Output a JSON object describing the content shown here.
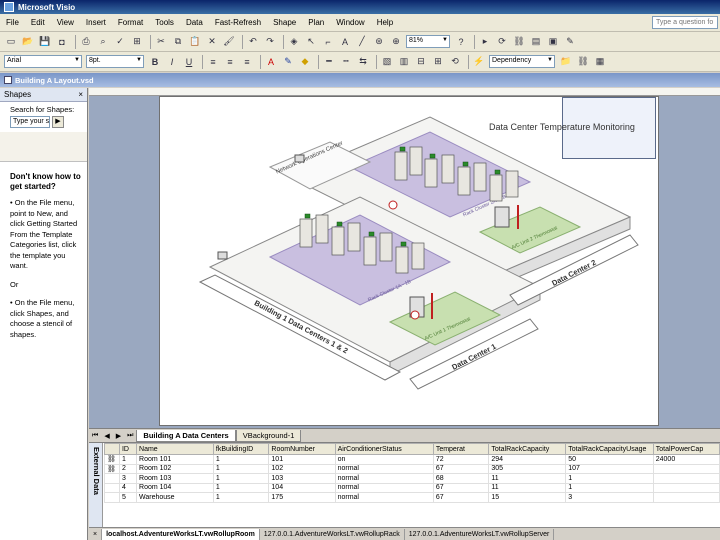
{
  "window": {
    "title": "Microsoft Visio"
  },
  "menu": {
    "items": [
      "File",
      "Edit",
      "View",
      "Insert",
      "Format",
      "Tools",
      "Data",
      "Fast-Refresh",
      "Shape",
      "Plan",
      "Window",
      "Help"
    ],
    "help_placeholder": "Type a question fo"
  },
  "toolbar1": {
    "zoom": "81%"
  },
  "toolbar2": {
    "font": "Arial",
    "size": "8pt.",
    "dependency": "Dependency"
  },
  "document": {
    "title": "Building A Layout.vsd"
  },
  "shapes_pane": {
    "title": "Shapes",
    "search_label": "Search for Shapes:",
    "search_placeholder": "Type your s",
    "help_heading": "Don't know how to get started?",
    "help_steps": [
      "On the File menu, point to New, and click Getting Started From the Template Categories list, click the template you want.",
      "On the File menu, click Shapes, and choose a stencil of shapes."
    ],
    "or_text": "Or",
    "bullet": "•"
  },
  "diagram": {
    "title": "Data Center Temperature Monitoring",
    "labels": {
      "building": "Building 1 Data Centers 1 & 2",
      "dc1": "Data Center 1",
      "dc2": "Data Center 2",
      "noc": "Network Operations Center",
      "rack_cluster_1": "Rack Cluster 1A - 1B",
      "rack_cluster_2": "Rack Cluster 2A - 2B",
      "ac_unit_1": "A/C Unit 1 Thermostat",
      "ac_unit_2": "A/C Unit 2 Thermostat"
    }
  },
  "page_tabs": {
    "active": "Building A Data Centers",
    "other": "VBackground-1"
  },
  "external_data": {
    "label": "External Data",
    "columns": [
      "",
      "ID",
      "Name",
      "fkBuildingID",
      "RoomNumber",
      "AirConditionerStatus",
      "Temperat",
      "TotalRackCapacity",
      "TotalRackCapacityUsage",
      "TotalPowerCap"
    ],
    "rows": [
      [
        "",
        "1",
        "Room 101",
        "1",
        "101",
        "on",
        "72",
        "294",
        "50",
        "24000"
      ],
      [
        "",
        "2",
        "Room 102",
        "1",
        "102",
        "normal",
        "67",
        "305",
        "107",
        ""
      ],
      [
        "",
        "3",
        "Room 103",
        "1",
        "103",
        "normal",
        "68",
        "11",
        "1",
        ""
      ],
      [
        "",
        "4",
        "Room 104",
        "1",
        "104",
        "normal",
        "67",
        "11",
        "1",
        ""
      ],
      [
        "",
        "5",
        "Warehouse",
        "1",
        "175",
        "normal",
        "67",
        "15",
        "3",
        ""
      ]
    ],
    "tabs": [
      "localhost.AdventureWorksLT.vwRollupRoom",
      "127.0.0.1.AdventureWorksLT.vwRollupRack",
      "127.0.0.1.AdventureWorksLT.vwRollupServer"
    ]
  }
}
